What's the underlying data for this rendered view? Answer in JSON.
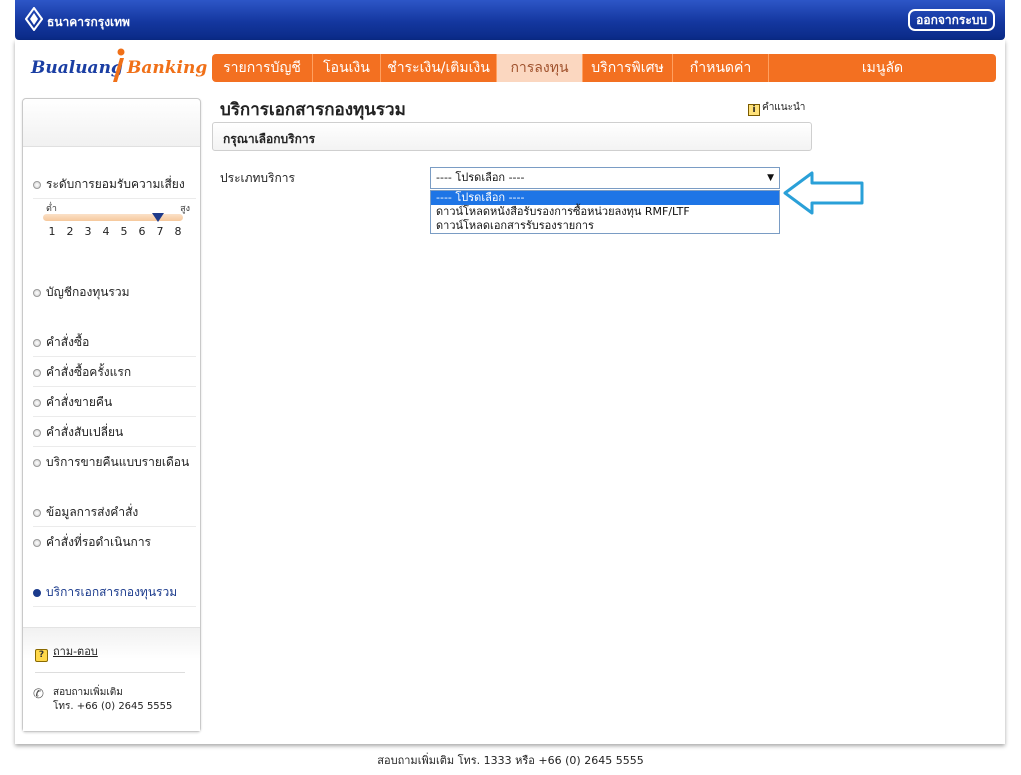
{
  "header": {
    "bank_name": "ธนาคารกรุงเทพ",
    "logout_label": "ออกจากระบบ"
  },
  "brand": {
    "left": "Bualuang",
    "right": "Banking"
  },
  "nav": {
    "items": [
      {
        "label": "รายการบัญชี",
        "active": false
      },
      {
        "label": "โอนเงิน",
        "active": false
      },
      {
        "label": "ชำระเงิน/เติมเงิน",
        "active": false
      },
      {
        "label": "การลงทุน",
        "active": true
      },
      {
        "label": "บริการพิเศษ",
        "active": false
      },
      {
        "label": "กำหนดค่า",
        "active": false
      },
      {
        "label": "เมนูลัด",
        "active": false
      }
    ]
  },
  "sidebar": {
    "risk_label": "ระดับการยอมรับความเสี่ยง",
    "risk_low": "ต่ำ",
    "risk_high": "สูง",
    "risk_level": 7,
    "risk_numbers": [
      "1",
      "2",
      "3",
      "4",
      "5",
      "6",
      "7",
      "8"
    ],
    "items": [
      {
        "label": "บัญชีกองทุนรวม"
      },
      {
        "label": "คำสั่งซื้อ"
      },
      {
        "label": "คำสั่งซื้อครั้งแรก"
      },
      {
        "label": "คำสั่งขายคืน"
      },
      {
        "label": "คำสั่งสับเปลี่ยน"
      },
      {
        "label": "บริการขายคืนแบบรายเดือน"
      },
      {
        "label": "ข้อมูลการส่งคำสั่ง"
      },
      {
        "label": "คำสั่งที่รอดำเนินการ"
      },
      {
        "label": "บริการเอกสารกองทุนรวม",
        "active": true
      }
    ],
    "faq_label": "ถาม-ตอบ",
    "contact_line1": "สอบถามเพิ่มเติม",
    "contact_line2": "โทร. +66 (0) 2645 5555"
  },
  "main": {
    "title": "บริการเอกสารกองทุนรวม",
    "help_label": "คำแนะนำ",
    "section_label": "กรุณาเลือกบริการ",
    "field_label": "ประเภทบริการ",
    "select_value": "---- โปรดเลือก ----",
    "options": [
      "---- โปรดเลือก ----",
      "ดาวน์โหลดหนังสือรับรองการซื้อหน่วยลงทุน RMF/LTF",
      "ดาวน์โหลดเอกสารรับรองรายการ"
    ],
    "selected_index": 0
  },
  "footer": {
    "text": "สอบถามเพิ่มเติม โทร. 1333 หรือ +66 (0) 2645 5555"
  },
  "colors": {
    "header_blue": "#14379f",
    "nav_orange": "#f37021",
    "nav_active_bg": "#fbd7c0",
    "annotation_arrow": "#2aa0d8",
    "option_highlight": "#1e75e6"
  }
}
